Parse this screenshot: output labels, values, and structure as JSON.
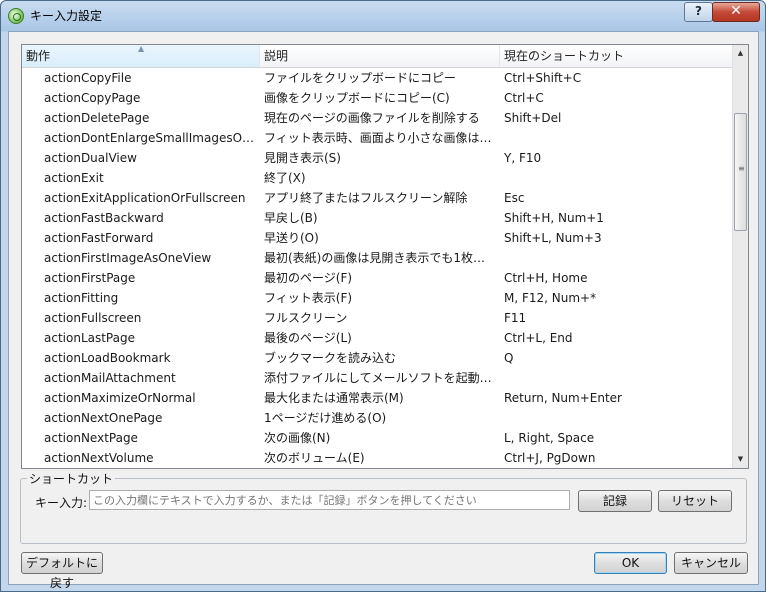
{
  "window": {
    "title": "キー入力設定",
    "help_label": "?",
    "close_label": "✕"
  },
  "table": {
    "columns": [
      "動作",
      "説明",
      "現在のショートカット"
    ],
    "sort_indicator": "▲",
    "rows": [
      {
        "action": "actionCopyFile",
        "desc": "ファイルをクリップボードにコピー",
        "shortcut": "Ctrl+Shift+C"
      },
      {
        "action": "actionCopyPage",
        "desc": "画像をクリップボードにコピー(C)",
        "shortcut": "Ctrl+C"
      },
      {
        "action": "actionDeletePage",
        "desc": "現在のページの画像ファイルを削除する",
        "shortcut": "Shift+Del"
      },
      {
        "action": "actionDontEnlargeSmallImagesOn…",
        "desc": "フィット表示時、画面より小さな画像は…",
        "shortcut": ""
      },
      {
        "action": "actionDualView",
        "desc": "見開き表示(S)",
        "shortcut": "Y, F10"
      },
      {
        "action": "actionExit",
        "desc": "終了(X)",
        "shortcut": ""
      },
      {
        "action": "actionExitApplicationOrFullscreen",
        "desc": "アプリ終了またはフルスクリーン解除",
        "shortcut": "Esc"
      },
      {
        "action": "actionFastBackward",
        "desc": "早戻し(B)",
        "shortcut": "Shift+H, Num+1"
      },
      {
        "action": "actionFastForward",
        "desc": "早送り(O)",
        "shortcut": "Shift+L, Num+3"
      },
      {
        "action": "actionFirstImageAsOneView",
        "desc": "最初(表紙)の画像は見開き表示でも1枚だ…",
        "shortcut": ""
      },
      {
        "action": "actionFirstPage",
        "desc": "最初のページ(F)",
        "shortcut": "Ctrl+H, Home"
      },
      {
        "action": "actionFitting",
        "desc": "フィット表示(F)",
        "shortcut": "M, F12, Num+*"
      },
      {
        "action": "actionFullscreen",
        "desc": "フルスクリーン",
        "shortcut": "F11"
      },
      {
        "action": "actionLastPage",
        "desc": "最後のページ(L)",
        "shortcut": "Ctrl+L, End"
      },
      {
        "action": "actionLoadBookmark",
        "desc": "ブックマークを読み込む",
        "shortcut": "Q"
      },
      {
        "action": "actionMailAttachment",
        "desc": "添付ファイルにしてメールソフトを起動…",
        "shortcut": ""
      },
      {
        "action": "actionMaximizeOrNormal",
        "desc": "最大化または通常表示(M)",
        "shortcut": "Return, Num+Enter"
      },
      {
        "action": "actionNextOnePage",
        "desc": "1ページだけ進める(O)",
        "shortcut": ""
      },
      {
        "action": "actionNextPage",
        "desc": "次の画像(N)",
        "shortcut": "L, Right, Space"
      },
      {
        "action": "actionNextVolume",
        "desc": "次のボリューム(E)",
        "shortcut": "Ctrl+J, PgDown"
      }
    ],
    "scroll_up": "▲",
    "scroll_down": "▼",
    "scroll_grip": "≡"
  },
  "shortcut_group": {
    "legend": "ショートカット",
    "key_label": "キー入力:",
    "key_placeholder": "この入力欄にテキストで入力するか、または「記録」ボタンを押してください",
    "record_label": "記録",
    "reset_label": "リセット"
  },
  "footer": {
    "default_label": "デフォルトに戻す",
    "ok_label": "OK",
    "cancel_label": "キャンセル"
  }
}
